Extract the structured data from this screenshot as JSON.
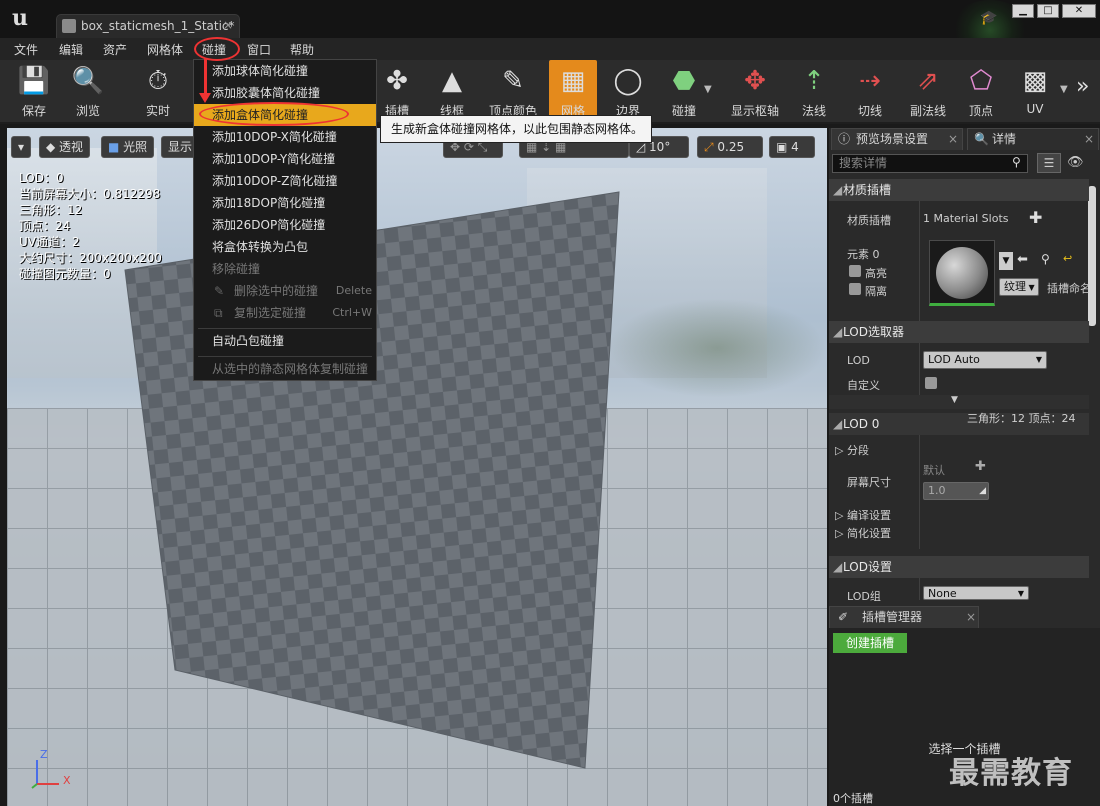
{
  "window": {
    "tab_title": "box_staticmesh_1_Static*",
    "tab_close": "×",
    "logo": "u",
    "minimize": "▁",
    "maximize": "□",
    "close": "✕"
  },
  "menubar": [
    "文件",
    "编辑",
    "资产",
    "网格体",
    "碰撞",
    "窗口",
    "帮助"
  ],
  "toolbar_left": [
    {
      "label": "保存",
      "icon": "save-icon",
      "glyph": "💾"
    },
    {
      "label": "浏览",
      "icon": "magnifier-icon",
      "glyph": "🔍"
    },
    {
      "label": "实时",
      "icon": "stopwatch-icon",
      "glyph": "⏱"
    }
  ],
  "toolbar_right": [
    {
      "label": "插槽",
      "icon": "socket-icon",
      "glyph": "✤"
    },
    {
      "label": "线框",
      "icon": "wireframe-icon",
      "glyph": "▲"
    },
    {
      "label": "顶点颜色",
      "icon": "brush-icon",
      "glyph": "✎"
    },
    {
      "label": "网格",
      "icon": "grid-icon",
      "glyph": "▦"
    },
    {
      "label": "边界",
      "icon": "bounds-icon",
      "glyph": "◯"
    },
    {
      "label": "碰撞",
      "icon": "collision-icon",
      "glyph": "⬣"
    },
    {
      "label": "显示枢轴",
      "icon": "pivot-icon",
      "glyph": "✥"
    },
    {
      "label": "法线",
      "icon": "normals-icon",
      "glyph": "⇡"
    },
    {
      "label": "切线",
      "icon": "tangents-icon",
      "glyph": "⇢"
    },
    {
      "label": "副法线",
      "icon": "binormals-icon",
      "glyph": "⇗"
    },
    {
      "label": "顶点",
      "icon": "vertices-icon",
      "glyph": "⬠"
    },
    {
      "label": "UV",
      "icon": "uv-icon",
      "glyph": "▩"
    }
  ],
  "toolbar_more": "»",
  "collision_menu": {
    "items": [
      {
        "label": "添加球体简化碰撞",
        "enabled": true
      },
      {
        "label": "添加胶囊体简化碰撞",
        "enabled": true
      },
      {
        "label": "添加盒体简化碰撞",
        "enabled": true,
        "highlighted": true
      },
      {
        "label": "添加10DOP-X简化碰撞",
        "enabled": true
      },
      {
        "label": "添加10DOP-Y简化碰撞",
        "enabled": true
      },
      {
        "label": "添加10DOP-Z简化碰撞",
        "enabled": true
      },
      {
        "label": "添加18DOP简化碰撞",
        "enabled": true
      },
      {
        "label": "添加26DOP简化碰撞",
        "enabled": true
      },
      {
        "label": "将盒体转换为凸包",
        "enabled": true
      },
      {
        "label": "移除碰撞",
        "enabled": false
      },
      {
        "label": "删除选中的碰撞",
        "enabled": false,
        "shortcut": "Delete"
      },
      {
        "label": "复制选定碰撞",
        "enabled": false,
        "shortcut": "Ctrl+W"
      },
      {
        "label": "自动凸包碰撞",
        "enabled": true
      },
      {
        "label": "从选中的静态网格体复制碰撞",
        "enabled": false
      }
    ],
    "tooltip": "生成新盒体碰撞网格体，以此包围静态网格体。"
  },
  "viewport": {
    "buttons": {
      "menu": "▾",
      "perspective": "透视",
      "lit": "光照",
      "show": "显示"
    },
    "snap": {
      "rotation": "10°",
      "scale": "0.25",
      "camera_speed": "4"
    },
    "stats": [
      "LOD：0",
      "当前屏幕大小：0.812298",
      "三角形：12",
      "顶点：24",
      "UV通道：2",
      "大约尺寸：200x200x200",
      "碰撞图元数量：0"
    ],
    "axis": {
      "z": "Z",
      "x": "X"
    }
  },
  "right_panel": {
    "tabs": [
      "预览场景设置",
      "详情"
    ],
    "search_placeholder": "搜索详情",
    "material_section": "材质插槽",
    "material_slots_label": "材质插槽",
    "material_slots_value": "1 Material Slots",
    "element_label": "元素 0",
    "highlight_label": "高亮",
    "isolate_label": "隔离",
    "texture_button": "纹理",
    "slot_name_label": "插槽命名",
    "lod_picker_section": "LOD选取器",
    "lod_label": "LOD",
    "lod_value": "LOD Auto",
    "custom_label": "自定义",
    "lod0_section": "LOD 0",
    "lod0_stats": "三角形：12    顶点：24",
    "sections_label": "分段",
    "screen_size_label": "屏幕尺寸",
    "default_label": "默认",
    "screen_size_value": "1.0",
    "build_settings_label": "编译设置",
    "reduction_settings_label": "简化设置",
    "lod_settings_section": "LOD设置",
    "lod_group_label": "LOD组",
    "lod_group_value": "None"
  },
  "socket_manager": {
    "tab": "插槽管理器",
    "create_button": "创建插槽",
    "select_hint": "选择一个插槽",
    "count": "0个插槽"
  },
  "watermark": "最需教育",
  "colors": {
    "accent": "#e8a81c",
    "annotation": "#e33333",
    "create_socket": "#4caa3c",
    "toolbar_active": "#e48a1c"
  }
}
